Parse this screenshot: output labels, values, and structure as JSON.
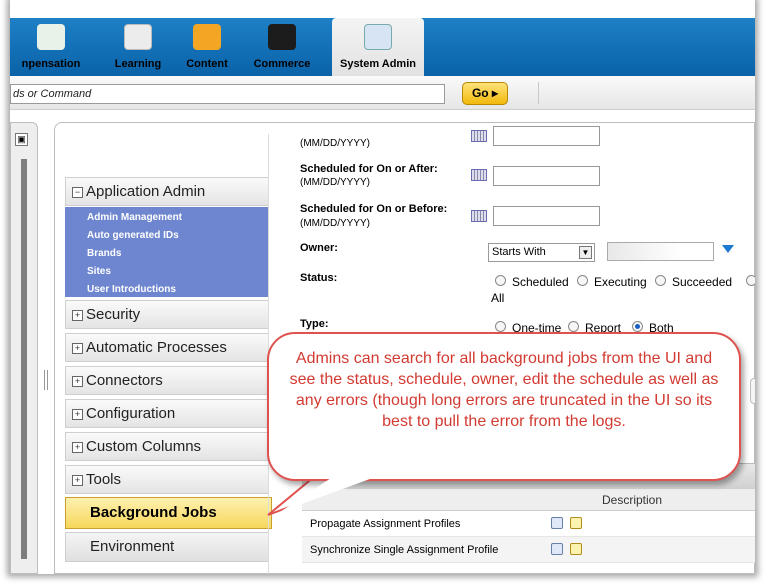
{
  "nav": {
    "tabs": [
      {
        "label": "npensation",
        "color": "#2e9a4a"
      },
      {
        "label": "Learning",
        "color": "#dcdcdc"
      },
      {
        "label": "Content",
        "color": "#f0a020"
      },
      {
        "label": "Commerce",
        "color": "#222222"
      },
      {
        "label": "System Admin",
        "color": "#2b6fb5"
      }
    ],
    "active_tab": "System Admin"
  },
  "command_bar": {
    "placeholder": "ds or Command",
    "go_label": "Go"
  },
  "sidebar": {
    "sections": [
      {
        "label": "Application Admin",
        "expanded": true
      },
      {
        "label": "Security"
      },
      {
        "label": "Automatic Processes"
      },
      {
        "label": "Connectors"
      },
      {
        "label": "Configuration"
      },
      {
        "label": "Custom Columns"
      },
      {
        "label": "Tools"
      }
    ],
    "app_admin_items": [
      "Admin Management",
      "Auto generated IDs",
      "Brands",
      "Sites",
      "User Introductions"
    ],
    "selected": "Background Jobs",
    "next": "Environment"
  },
  "form": {
    "date_hint": "(MM/DD/YYYY)",
    "scheduled_after_label": "Scheduled for On or After:",
    "scheduled_before_label": "Scheduled for On or Before:",
    "owner_label": "Owner:",
    "owner_operator": "Starts With",
    "status_label": "Status:",
    "status_options": [
      "Scheduled",
      "Executing",
      "Succeeded",
      "All"
    ],
    "type_label": "Type:",
    "type_options": [
      "One-time",
      "Report",
      "Both"
    ],
    "type_selected": "Both"
  },
  "grid": {
    "description_header": "Description",
    "rows": [
      "Propagate Assignment Profiles",
      "Synchronize Single Assignment Profile"
    ]
  },
  "callout": {
    "text": "Admins can search for all background jobs from the UI and see the status, schedule, owner, edit the schedule as well as any errors (though long errors are truncated in the UI so its best to pull the error from the logs."
  },
  "colors": {
    "nav_blue": "#1e80c6",
    "submenu_blue": "#6e86cf",
    "selected_yellow": "#f7d75c",
    "callout_red": "#d23a32"
  }
}
